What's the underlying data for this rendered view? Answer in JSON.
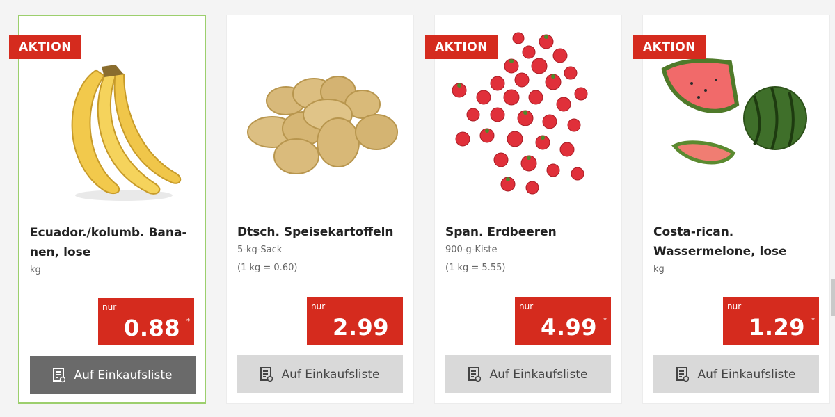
{
  "products": [
    {
      "badge": "AKTION",
      "image": "bananas",
      "title": "Ecuador./kolumb. Bana-nen, lose",
      "unit": "kg",
      "base_price": "",
      "price_label": "nur",
      "price": "0.88",
      "price_marker": "*",
      "button_label": "Auf Einkaufsliste",
      "button_icon": "shopping-list-icon",
      "selected": true
    },
    {
      "badge": "",
      "image": "potatoes",
      "title": "Dtsch. Speisekartoffeln",
      "unit": "5-kg-Sack",
      "base_price": "(1 kg = 0.60)",
      "price_label": "nur",
      "price": "2.99",
      "price_marker": "",
      "button_label": "Auf Einkaufsliste",
      "button_icon": "shopping-list-icon",
      "selected": false
    },
    {
      "badge": "AKTION",
      "image": "strawberries",
      "title": "Span. Erdbeeren",
      "unit": "900-g-Kiste",
      "base_price": "(1 kg = 5.55)",
      "price_label": "nur",
      "price": "4.99",
      "price_marker": "*",
      "button_label": "Auf Einkaufsliste",
      "button_icon": "shopping-list-icon",
      "selected": false
    },
    {
      "badge": "AKTION",
      "image": "watermelon",
      "title": "Costa-rican. Wassermelone, lose",
      "unit": "kg",
      "base_price": "",
      "price_label": "nur",
      "price": "1.29",
      "price_marker": "*",
      "button_label": "Auf Einkaufsliste",
      "button_icon": "shopping-list-icon",
      "selected": false
    }
  ],
  "colors": {
    "accent_red": "#d52b1e",
    "selected_border": "#9ccf6d",
    "button_gray": "#d9d9d9",
    "button_dark": "#6a6a6a"
  }
}
